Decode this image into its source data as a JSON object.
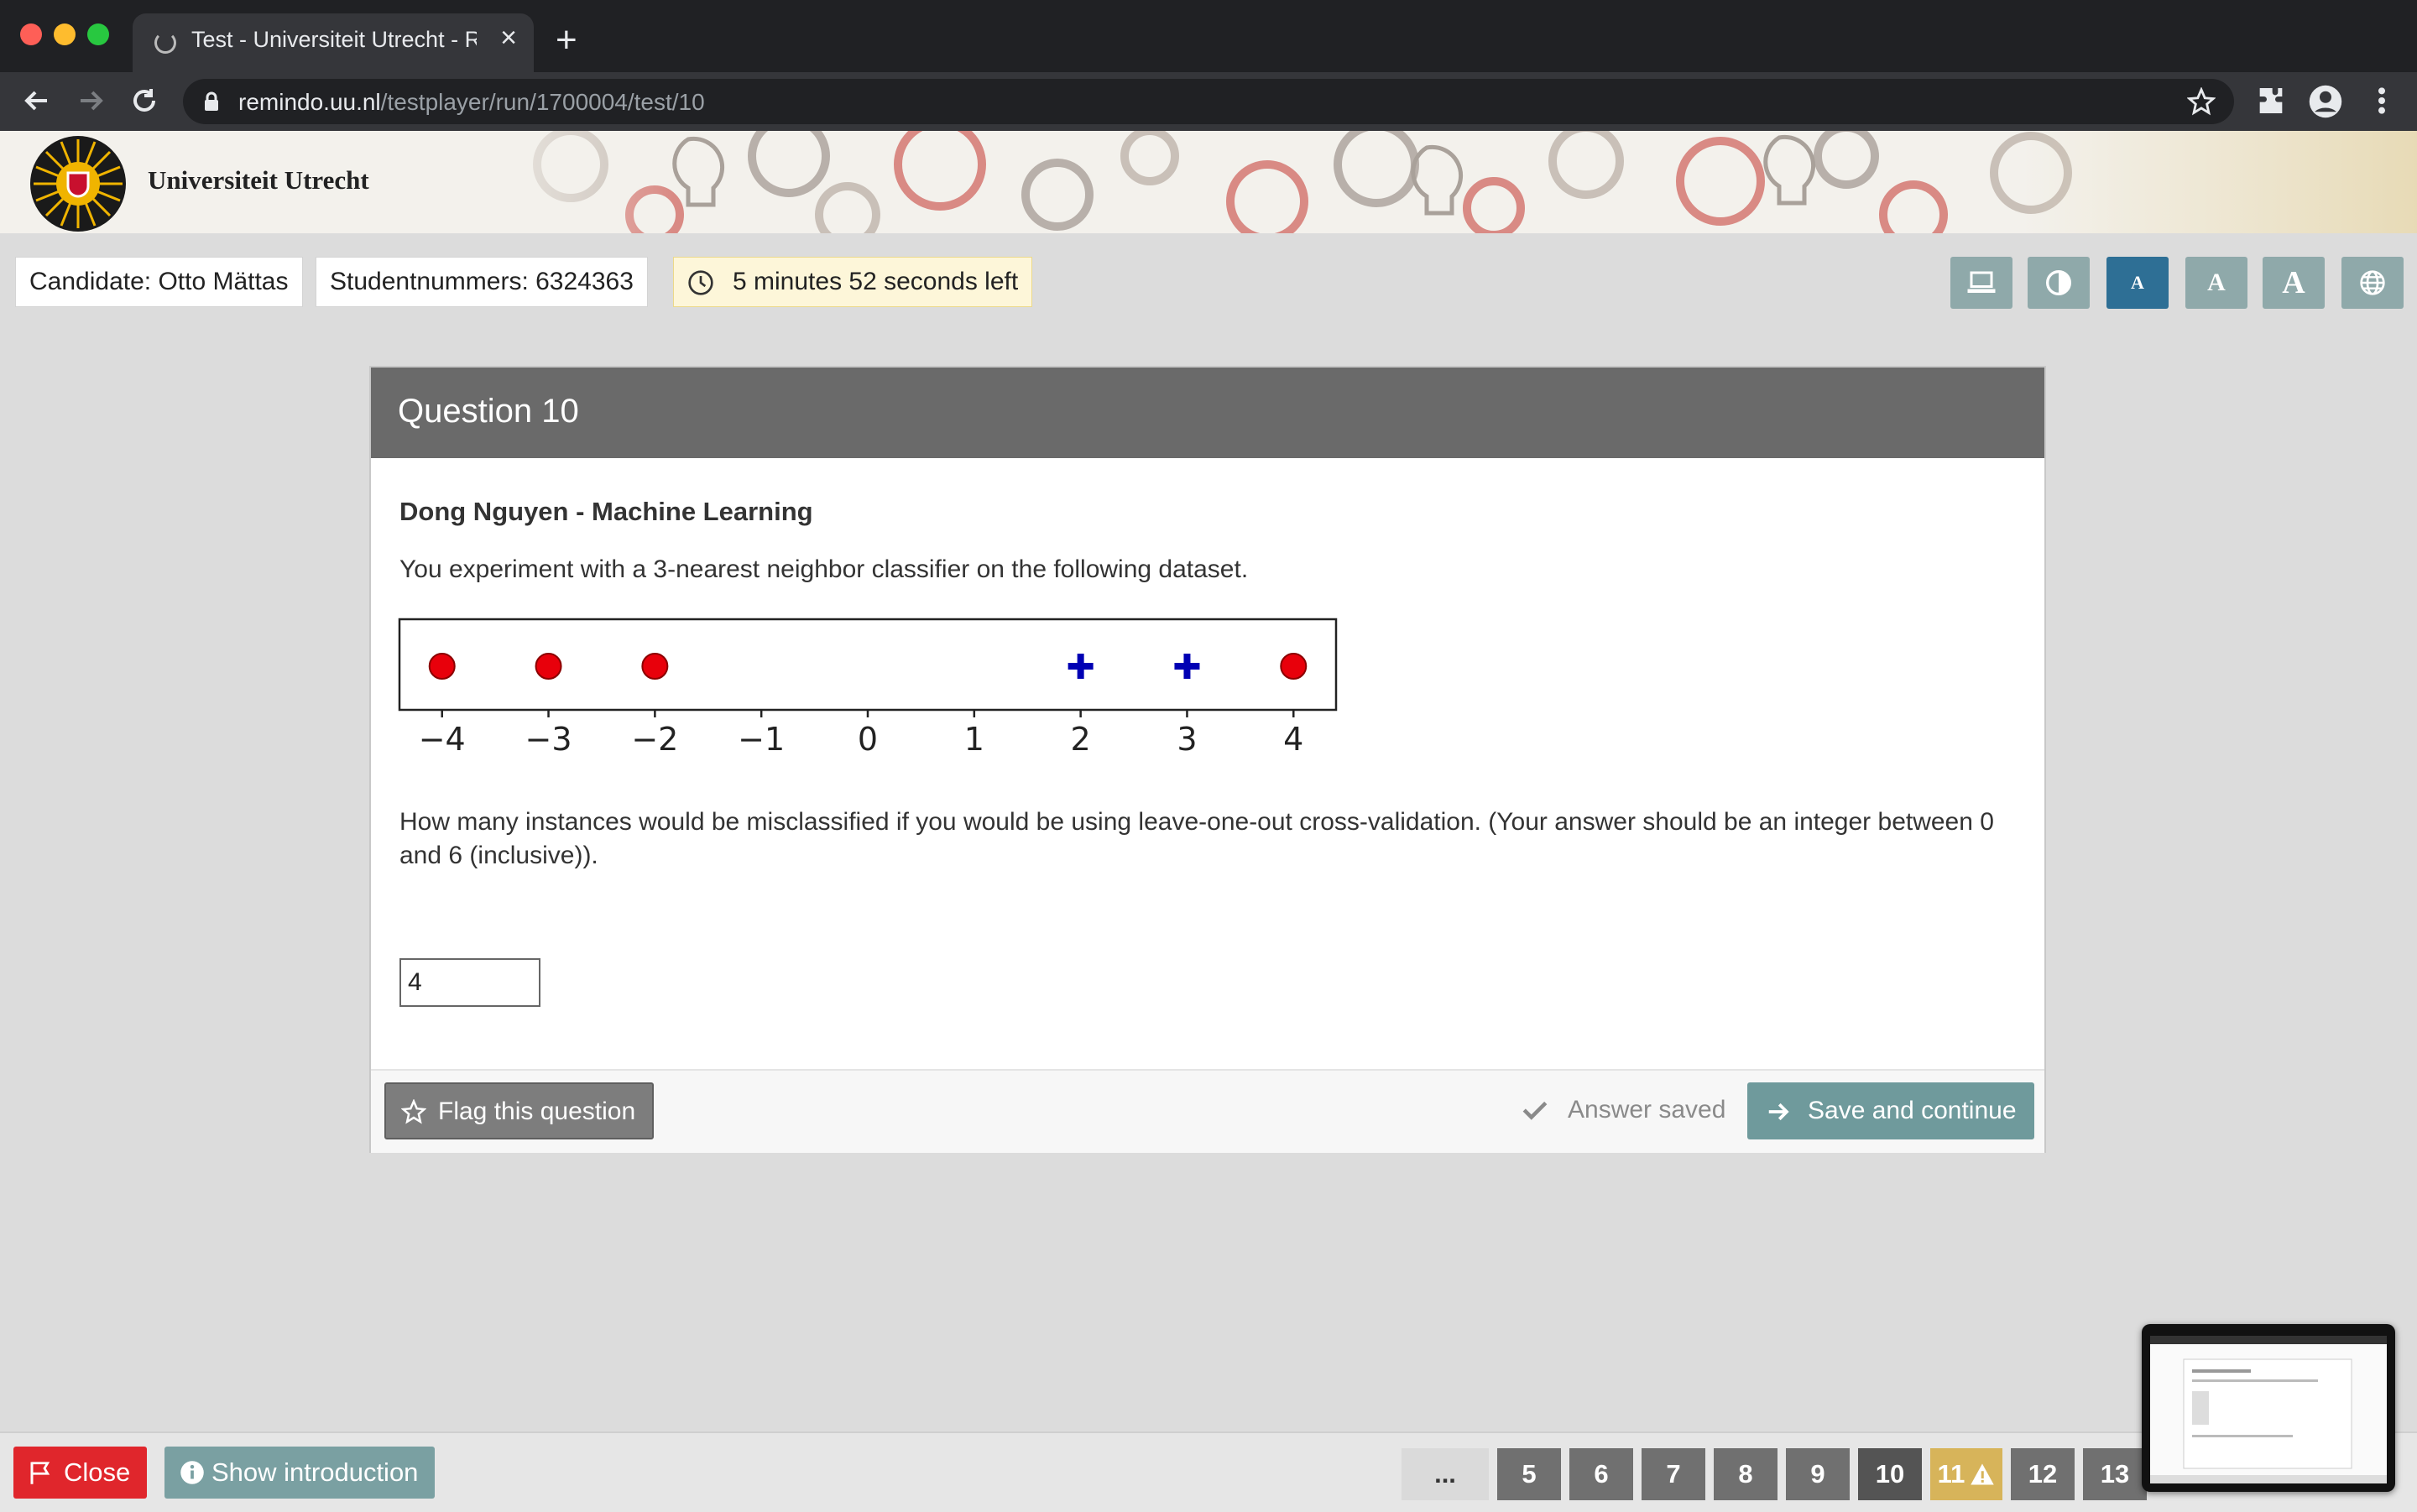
{
  "browser": {
    "tab_title": "Test - Universiteit Utrecht - Remindo",
    "url_host": "remindo.uu.nl",
    "url_path": "/testplayer/run/1700004/test/10"
  },
  "header": {
    "institution": "Universiteit Utrecht"
  },
  "info": {
    "candidate": "Candidate: Otto Mättas",
    "student_number": "Studentnummers: 6324363",
    "timer": "5 minutes 52 seconds left"
  },
  "accessibility": {
    "font_small": "A",
    "font_medium": "A",
    "font_large": "A"
  },
  "question": {
    "title": "Question 10",
    "course": "Dong Nguyen - Machine Learning",
    "intro": "You experiment with a 3-nearest neighbor classifier on the following dataset.",
    "text": "How many instances would be misclassified if you would be using leave-one-out cross-validation. (Your answer should be an integer between 0 and 6 (inclusive)).",
    "answer_value": "4"
  },
  "plot": {
    "x_ticks": [
      "−4",
      "−3",
      "−2",
      "−1",
      "0",
      "1",
      "2",
      "3",
      "4"
    ],
    "points": [
      {
        "x": -4,
        "class": "circle"
      },
      {
        "x": -3,
        "class": "circle"
      },
      {
        "x": -2,
        "class": "circle"
      },
      {
        "x": 2,
        "class": "plus"
      },
      {
        "x": 3,
        "class": "plus"
      },
      {
        "x": 4,
        "class": "circle"
      }
    ],
    "x_range": [
      -4.4,
      4.4
    ],
    "circle_color": "#e8000b",
    "plus_color": "#0000b4"
  },
  "actions": {
    "flag_label": "Flag this question",
    "saved_label": "Answer saved",
    "save_label": "Save and continue"
  },
  "footer": {
    "close_label": "Close",
    "intro_label": "Show introduction",
    "nav_ellipsis": "...",
    "nav": [
      "5",
      "6",
      "7",
      "8",
      "9",
      "10",
      "11",
      "12",
      "13"
    ],
    "current": "10",
    "flagged": "11"
  }
}
